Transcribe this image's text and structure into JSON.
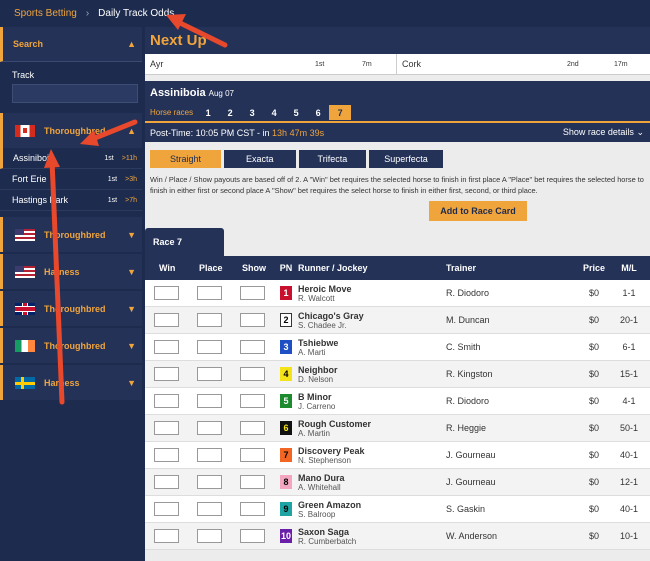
{
  "breadcrumb": {
    "link": "Sports Betting",
    "current": "Daily Track Odds"
  },
  "sidebar": {
    "search_label": "Search",
    "track_label": "Track",
    "groups": [
      {
        "label": "Thoroughbred",
        "flag": "canada-flag-icon",
        "expanded": true,
        "tracks": [
          {
            "name": "Assiniboia",
            "post": "1st",
            "time": ">11h",
            "active": true
          },
          {
            "name": "Fort Erie",
            "post": "1st",
            "time": ">3h",
            "active": false
          },
          {
            "name": "Hastings Park",
            "post": "1st",
            "time": ">7h",
            "active": false
          }
        ]
      },
      {
        "label": "Thoroughbred",
        "flag": "usa-flag-icon",
        "expanded": false
      },
      {
        "label": "Harness",
        "flag": "usa-flag-icon",
        "expanded": false
      },
      {
        "label": "Thoroughbred",
        "flag": "uk-flag-icon",
        "expanded": false
      },
      {
        "label": "Thoroughbred",
        "flag": "ireland-flag-icon",
        "expanded": false
      },
      {
        "label": "Harness",
        "flag": "sweden-flag-icon",
        "expanded": false
      }
    ]
  },
  "next_up": {
    "title": "Next Up",
    "items": [
      {
        "track": "Ayr",
        "race": "1st",
        "time": "7m"
      },
      {
        "track": "Cork",
        "race": "2nd",
        "time": "17m"
      }
    ]
  },
  "track": {
    "name": "Assiniboia",
    "date": "Aug 07",
    "horse_races_label": "Horse races",
    "races": [
      "1",
      "2",
      "3",
      "4",
      "5",
      "6",
      "7"
    ],
    "selected_race": "7"
  },
  "post_time": {
    "label": "Post-Time: 10:05 PM CST - in ",
    "countdown": "13h 47m 39s",
    "details": "Show race details"
  },
  "bet_types": [
    "Straight",
    "Exacta",
    "Trifecta",
    "Superfecta"
  ],
  "description": "Win / Place / Show payouts are based off of 2. A \"Win\" bet requires the selected horse to finish in first place A \"Place\" bet requires the selected horse to finish in either first or second place A \"Show\" bet requires the select horse to finish in either first, second, or third place.",
  "add_button": "Add to Race Card",
  "race_tab": "Race 7",
  "columns": {
    "win": "Win",
    "place": "Place",
    "show": "Show",
    "pn": "PN",
    "runner": "Runner / Jockey",
    "trainer": "Trainer",
    "price": "Price",
    "ml": "M/L"
  },
  "runners": [
    {
      "pn": "1",
      "name": "Heroic Move",
      "jockey": "R. Walcott",
      "trainer": "R. Diodoro",
      "price": "$0",
      "ml": "1-1",
      "bg": "#c8102e",
      "fg": "#ffffff"
    },
    {
      "pn": "2",
      "name": "Chicago's Gray",
      "jockey": "S. Chadee Jr.",
      "trainer": "M. Duncan",
      "price": "$0",
      "ml": "20-1",
      "bg": "#ffffff",
      "fg": "#000000"
    },
    {
      "pn": "3",
      "name": "Tshiebwe",
      "jockey": "A. Marti",
      "trainer": "C. Smith",
      "price": "$0",
      "ml": "6-1",
      "bg": "#1f4fc4",
      "fg": "#ffffff"
    },
    {
      "pn": "4",
      "name": "Neighbor",
      "jockey": "D. Nelson",
      "trainer": "R. Kingston",
      "price": "$0",
      "ml": "15-1",
      "bg": "#f5e31a",
      "fg": "#000000"
    },
    {
      "pn": "5",
      "name": "B Minor",
      "jockey": "J. Carreno",
      "trainer": "R. Diodoro",
      "price": "$0",
      "ml": "4-1",
      "bg": "#1d8a2e",
      "fg": "#ffffff"
    },
    {
      "pn": "6",
      "name": "Rough Customer",
      "jockey": "A. Martin",
      "trainer": "R. Heggie",
      "price": "$0",
      "ml": "50-1",
      "bg": "#111111",
      "fg": "#f5e31a"
    },
    {
      "pn": "7",
      "name": "Discovery Peak",
      "jockey": "N. Stephenson",
      "trainer": "J. Gourneau",
      "price": "$0",
      "ml": "40-1",
      "bg": "#f26522",
      "fg": "#000000"
    },
    {
      "pn": "8",
      "name": "Mano Dura",
      "jockey": "A. Whitehall",
      "trainer": "J. Gourneau",
      "price": "$0",
      "ml": "12-1",
      "bg": "#f4a6c0",
      "fg": "#000000"
    },
    {
      "pn": "9",
      "name": "Green Amazon",
      "jockey": "S. Balroop",
      "trainer": "S. Gaskin",
      "price": "$0",
      "ml": "40-1",
      "bg": "#1fa3a3",
      "fg": "#000000"
    },
    {
      "pn": "10",
      "name": "Saxon Saga",
      "jockey": "R. Cumberbatch",
      "trainer": "W. Anderson",
      "price": "$0",
      "ml": "10-1",
      "bg": "#6a1fa8",
      "fg": "#ffffff"
    }
  ],
  "colors": {
    "accent": "#f0a43c",
    "navy": "#1d2c4e",
    "panel": "#243258",
    "annotation": "#e8482c"
  }
}
